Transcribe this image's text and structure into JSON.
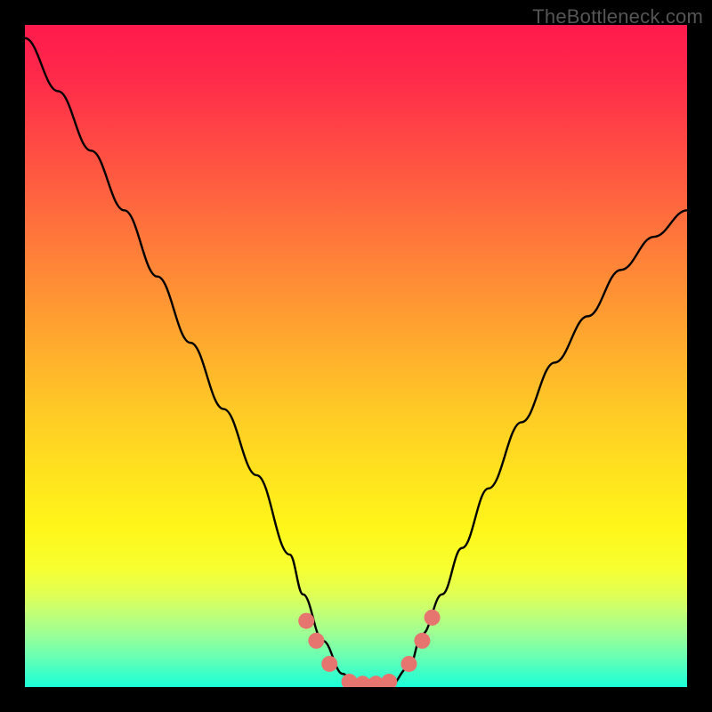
{
  "watermark": "TheBottleneck.com",
  "chart_data": {
    "type": "line",
    "title": "",
    "xlabel": "",
    "ylabel": "",
    "xlim": [
      0,
      100
    ],
    "ylim": [
      0,
      100
    ],
    "grid": false,
    "legend": false,
    "series": [
      {
        "name": "bottleneck-curve",
        "color": "#000000",
        "x": [
          0,
          5,
          10,
          15,
          20,
          25,
          30,
          35,
          40,
          42,
          45,
          48,
          50,
          52,
          55,
          58,
          60,
          63,
          66,
          70,
          75,
          80,
          85,
          90,
          95,
          100
        ],
        "y": [
          98,
          90,
          81,
          72,
          62,
          52,
          42,
          32,
          20,
          14,
          7,
          2,
          0,
          0,
          0,
          3,
          8,
          14,
          21,
          30,
          40,
          49,
          56,
          63,
          68,
          72
        ]
      }
    ],
    "markers": [
      {
        "name": "left-top-marker",
        "x": 42.5,
        "y": 10.0,
        "color": "#e6746f"
      },
      {
        "name": "left-mid-marker",
        "x": 44.0,
        "y": 7.0,
        "color": "#e6746f"
      },
      {
        "name": "left-bottom-marker",
        "x": 46.0,
        "y": 3.5,
        "color": "#e6746f"
      },
      {
        "name": "flat-1-marker",
        "x": 49.0,
        "y": 0.8,
        "color": "#e6746f"
      },
      {
        "name": "flat-2-marker",
        "x": 51.0,
        "y": 0.5,
        "color": "#e6746f"
      },
      {
        "name": "flat-3-marker",
        "x": 53.0,
        "y": 0.5,
        "color": "#e6746f"
      },
      {
        "name": "flat-4-marker",
        "x": 55.0,
        "y": 0.8,
        "color": "#e6746f"
      },
      {
        "name": "right-bottom-marker",
        "x": 58.0,
        "y": 3.5,
        "color": "#e6746f"
      },
      {
        "name": "right-mid-marker",
        "x": 60.0,
        "y": 7.0,
        "color": "#e6746f"
      },
      {
        "name": "right-top-marker",
        "x": 61.5,
        "y": 10.5,
        "color": "#e6746f"
      }
    ],
    "background_gradient": {
      "stops": [
        {
          "pos": 0,
          "color": "#ff1a4d"
        },
        {
          "pos": 8,
          "color": "#ff2a4a"
        },
        {
          "pos": 18,
          "color": "#ff4a44"
        },
        {
          "pos": 28,
          "color": "#ff6a3e"
        },
        {
          "pos": 38,
          "color": "#ff8a36"
        },
        {
          "pos": 48,
          "color": "#ffaa2e"
        },
        {
          "pos": 58,
          "color": "#ffc926"
        },
        {
          "pos": 68,
          "color": "#ffe31e"
        },
        {
          "pos": 76,
          "color": "#fff61a"
        },
        {
          "pos": 82,
          "color": "#f7ff30"
        },
        {
          "pos": 86,
          "color": "#e0ff55"
        },
        {
          "pos": 89,
          "color": "#c0ff78"
        },
        {
          "pos": 92,
          "color": "#9cff95"
        },
        {
          "pos": 95,
          "color": "#70ffb0"
        },
        {
          "pos": 98,
          "color": "#3cffc8"
        },
        {
          "pos": 100,
          "color": "#1affd8"
        }
      ]
    }
  }
}
